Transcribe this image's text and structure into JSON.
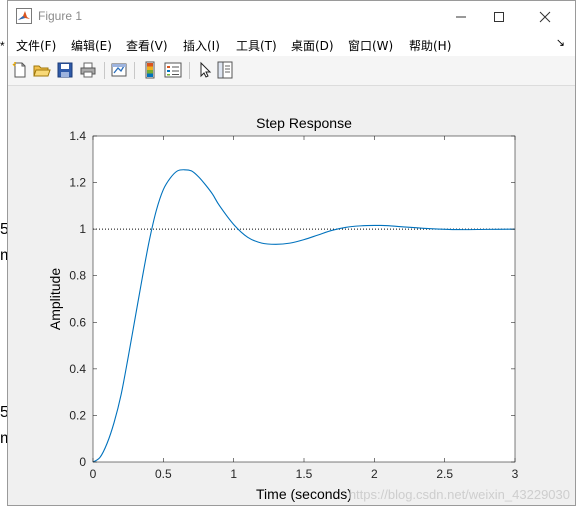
{
  "background_fragments": [
    "5",
    "m",
    "5",
    "m",
    "*"
  ],
  "window": {
    "title": "Figure 1",
    "controls": {
      "minimize_glyph": "—",
      "maximize_glyph": "☐",
      "close_glyph": "✕"
    }
  },
  "menu": [
    {
      "label": "文件(F)"
    },
    {
      "label": "编辑(E)"
    },
    {
      "label": "查看(V)"
    },
    {
      "label": "插入(I)"
    },
    {
      "label": "工具(T)"
    },
    {
      "label": "桌面(D)"
    },
    {
      "label": "窗口(W)"
    },
    {
      "label": "帮助(H)"
    }
  ],
  "menu_overflow_glyph": "↘",
  "toolbar": [
    "new-figure-icon",
    "open-file-icon",
    "save-icon",
    "print-icon",
    "link-plot-icon",
    "insert-colorbar-icon",
    "insert-legend-icon",
    "edit-plot-icon",
    "property-inspector-icon"
  ],
  "watermark": "https://blog.csdn.net/weixin_43229030",
  "colors": {
    "line": "#0072bd",
    "axes": "#262626",
    "grid": "#e6e6e6"
  },
  "chart_data": {
    "type": "line",
    "title": "Step Response",
    "xlabel": "Time (seconds)",
    "ylabel": "Amplitude",
    "xlim": [
      0,
      3
    ],
    "ylim": [
      0,
      1.4
    ],
    "xticks": [
      "0",
      "0.5",
      "1",
      "1.5",
      "2",
      "2.5",
      "3"
    ],
    "yticks": [
      "0",
      "0.2",
      "0.4",
      "0.6",
      "0.8",
      "1",
      "1.2",
      "1.4"
    ],
    "reference_line": {
      "y": 1,
      "style": "dotted"
    },
    "series": [
      {
        "x": [
          0,
          0.05,
          0.1,
          0.15,
          0.2,
          0.25,
          0.3,
          0.35,
          0.4,
          0.45,
          0.5,
          0.55,
          0.6,
          0.65,
          0.7,
          0.75,
          0.8,
          0.85,
          0.9,
          1.0,
          1.1,
          1.2,
          1.3,
          1.4,
          1.5,
          1.6,
          1.7,
          1.8,
          1.9,
          2.0,
          2.1,
          2.2,
          2.4,
          2.6,
          2.8,
          3.0
        ],
        "y": [
          0,
          0.02,
          0.08,
          0.17,
          0.29,
          0.45,
          0.62,
          0.79,
          0.95,
          1.08,
          1.17,
          1.22,
          1.25,
          1.255,
          1.25,
          1.225,
          1.19,
          1.15,
          1.1,
          1.02,
          0.965,
          0.94,
          0.935,
          0.94,
          0.955,
          0.975,
          0.995,
          1.008,
          1.014,
          1.016,
          1.015,
          1.01,
          1.002,
          0.998,
          0.999,
          1.0
        ]
      }
    ],
    "grid": false
  }
}
